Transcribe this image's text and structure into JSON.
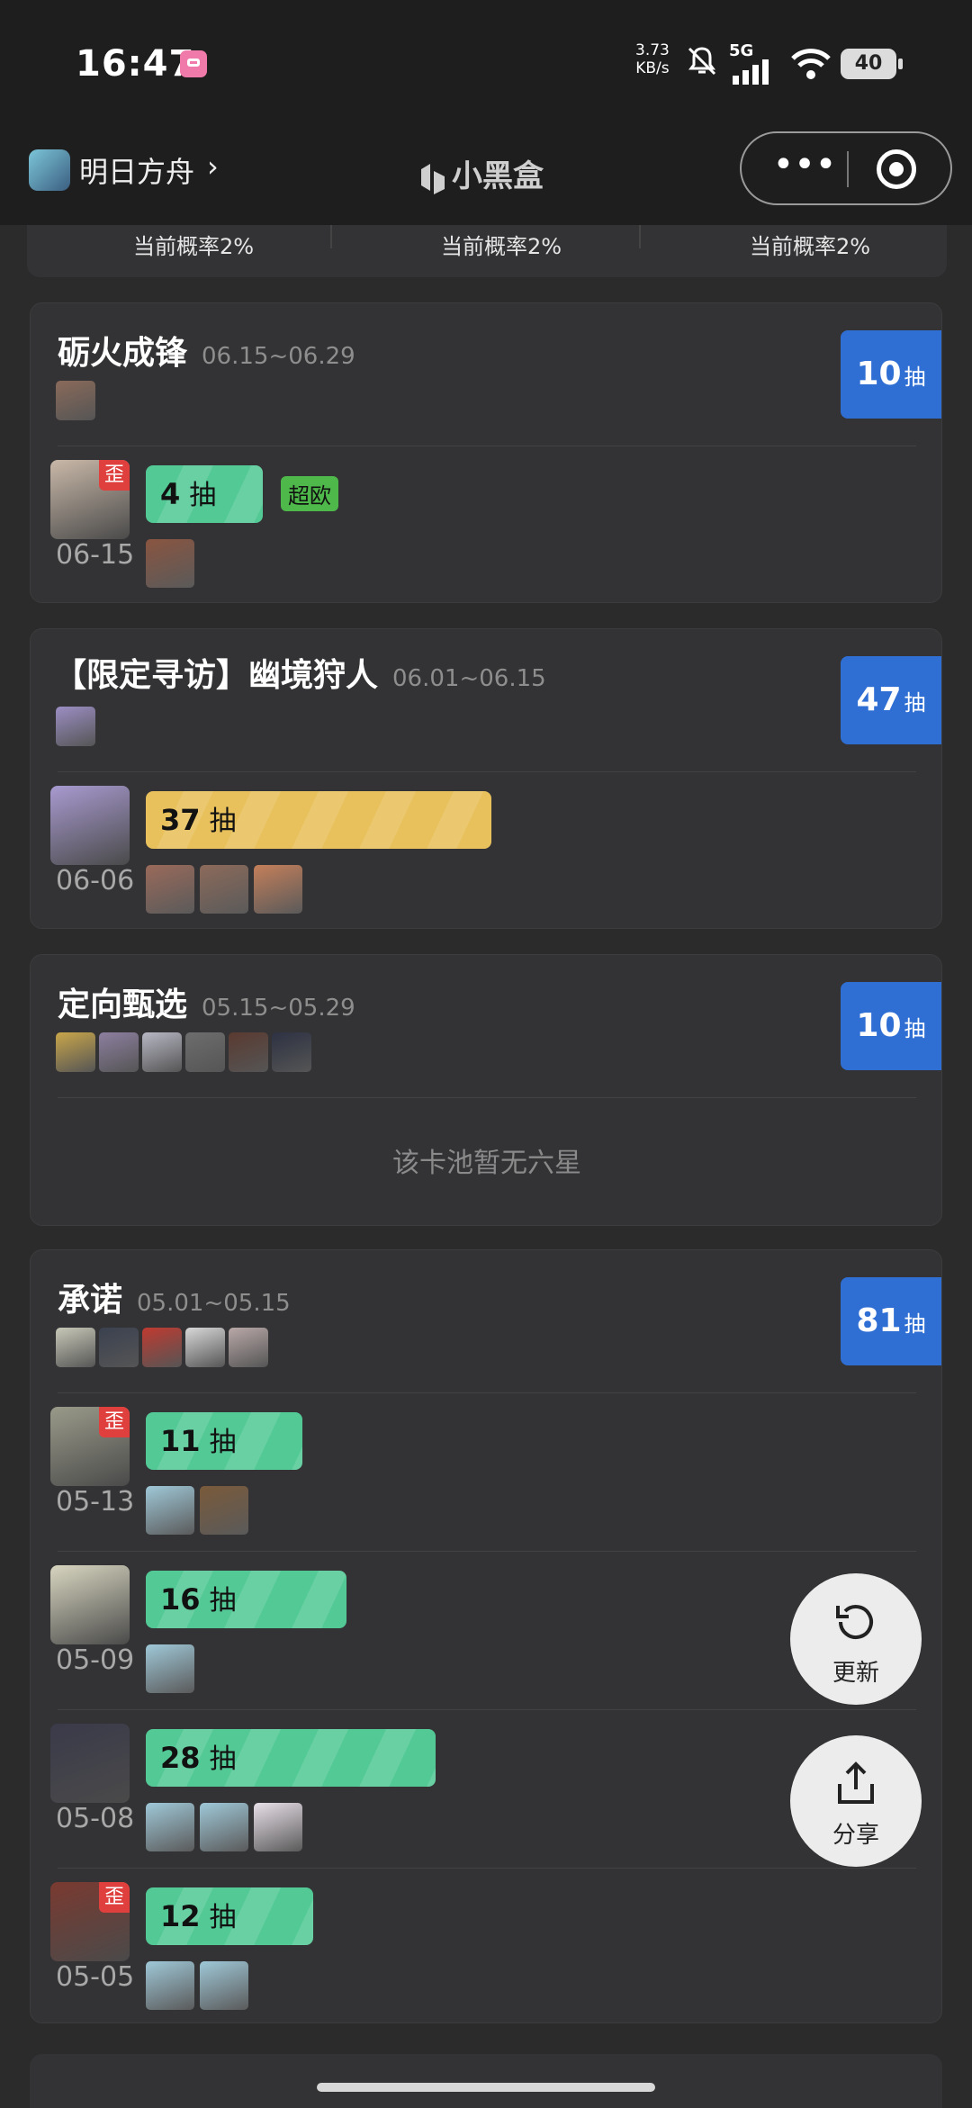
{
  "status_bar": {
    "time": "16:47",
    "net_speed_value": "3.73",
    "net_speed_unit": "KB/s",
    "network": "5G",
    "battery": "40"
  },
  "nav": {
    "app_name": "明日方舟",
    "brand": "小黑盒"
  },
  "rates": [
    "当前概率2%",
    "当前概率2%",
    "当前概率2%"
  ],
  "pools": [
    {
      "title": "砺火成锋",
      "date": "06.15~06.29",
      "pulls": "10",
      "pull_unit": "抽",
      "featured_colors": [
        "#8a6a5a"
      ],
      "sixes": [
        {
          "date": "06-15",
          "pulls": "4",
          "unit": "抽",
          "crooked": true,
          "crooked_label": "歪",
          "tag": "超欧",
          "fill": 0.14,
          "bar": "green",
          "avatar": "#c9b8a8",
          "guarantee": [
            "#8a5540"
          ]
        }
      ]
    },
    {
      "title": "【限定寻访】幽境狩人",
      "date": "06.01~06.15",
      "pulls": "47",
      "pull_unit": "抽",
      "featured_colors": [
        "#9c8ec4"
      ],
      "sixes": [
        {
          "date": "06-06",
          "pulls": "37",
          "unit": "抽",
          "crooked": false,
          "fill": 0.62,
          "bar": "gold",
          "avatar": "#a89ad0",
          "guarantee": [
            "#9a6a5a",
            "#8c6a5a",
            "#c47f5a"
          ]
        }
      ]
    },
    {
      "title": "定向甄选",
      "date": "05.15~05.29",
      "pulls": "10",
      "pull_unit": "抽",
      "featured_colors": [
        "#c9a64a",
        "#8d7fa0",
        "#b7b7c4",
        "#6d6d6d",
        "#5a3a30",
        "#2d3142"
      ],
      "empty": "该卡池暂无六星",
      "sixes": []
    },
    {
      "title": "承诺",
      "date": "05.01~05.15",
      "pulls": "81",
      "pull_unit": "抽",
      "featured_colors": [
        "#c8c8b8",
        "#3b4150",
        "#c03a30",
        "#d8d8d8",
        "#b9a8a8"
      ],
      "sixes": [
        {
          "date": "05-13",
          "pulls": "11",
          "unit": "抽",
          "crooked": true,
          "crooked_label": "歪",
          "fill": 0.28,
          "bar": "green",
          "avatar": "#9a9a8a",
          "guarantee": [
            "#9fc8d8",
            "#7a5a3a"
          ]
        },
        {
          "date": "05-09",
          "pulls": "16",
          "unit": "抽",
          "crooked": false,
          "fill": 0.36,
          "bar": "green",
          "avatar": "#d8d6c0",
          "guarantee": [
            "#9fc8d8"
          ]
        },
        {
          "date": "05-08",
          "pulls": "28",
          "unit": "抽",
          "crooked": false,
          "fill": 0.52,
          "bar": "green",
          "avatar": "#3a3a4a",
          "guarantee": [
            "#9fc8d8",
            "#9fc8d8",
            "#e8e0e8"
          ]
        },
        {
          "date": "05-05",
          "pulls": "12",
          "unit": "抽",
          "crooked": true,
          "crooked_label": "歪",
          "fill": 0.3,
          "bar": "green",
          "avatar": "#7a3a30",
          "guarantee": [
            "#9fc8d8",
            "#9fc8d8"
          ]
        }
      ]
    }
  ],
  "actions": {
    "refresh": "更新",
    "share": "分享"
  }
}
